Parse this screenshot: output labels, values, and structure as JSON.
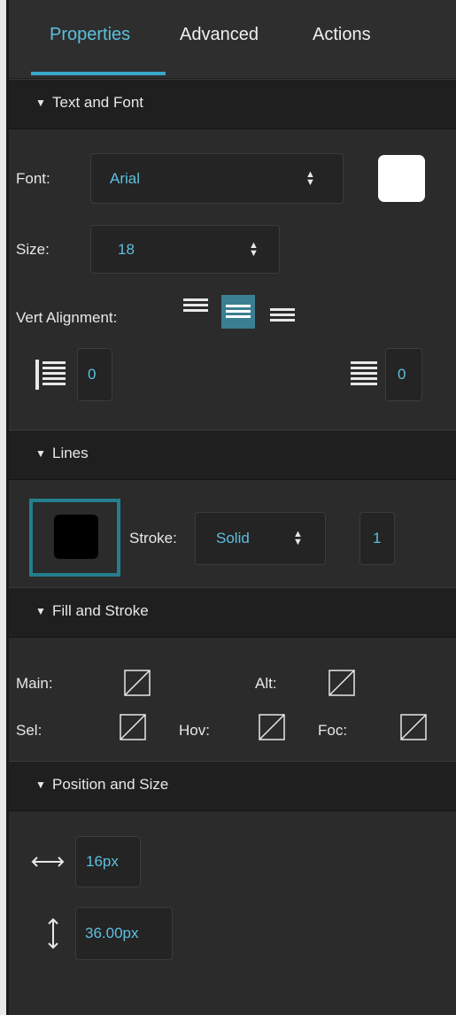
{
  "tabs": [
    {
      "label": "Properties",
      "active": true
    },
    {
      "label": "Advanced",
      "active": false
    },
    {
      "label": "Actions",
      "active": false
    }
  ],
  "sections": {
    "text_font": {
      "title": "Text and Font"
    },
    "lines": {
      "title": "Lines"
    },
    "fill_stroke": {
      "title": "Fill and Stroke"
    },
    "position_size": {
      "title": "Position and Size"
    }
  },
  "text_font": {
    "font_label": "Font:",
    "font_value": "Arial",
    "font_color": "#ffffff",
    "size_label": "Size:",
    "size_value": "18",
    "vert_alignment_label": "Vert Alignment:",
    "vert_alignment_selected": "middle",
    "line_spacing_value": "0",
    "paragraph_spacing_value": "0"
  },
  "lines": {
    "stroke_color": "#000000",
    "stroke_label": "Stroke:",
    "stroke_style": "Solid",
    "stroke_width": "1"
  },
  "fill_stroke": {
    "main_label": "Main:",
    "alt_label": "Alt:",
    "sel_label": "Sel:",
    "hov_label": "Hov:",
    "foc_label": "Foc:"
  },
  "position_size": {
    "width_value": "16px",
    "height_value": "36.00px"
  },
  "colors": {
    "accent": "#5cc0de",
    "panel_bg": "#2b2b2b",
    "header_bg": "#1f1f1f",
    "highlight_frame": "#237f8e"
  },
  "icons": [
    "triangle-down-icon",
    "updown-arrows-icon",
    "align-top-icon",
    "align-middle-icon",
    "align-bottom-icon",
    "line-spacing-icon",
    "paragraph-spacing-icon",
    "no-fill-icon",
    "horizontal-arrow-icon",
    "vertical-arrow-icon"
  ]
}
